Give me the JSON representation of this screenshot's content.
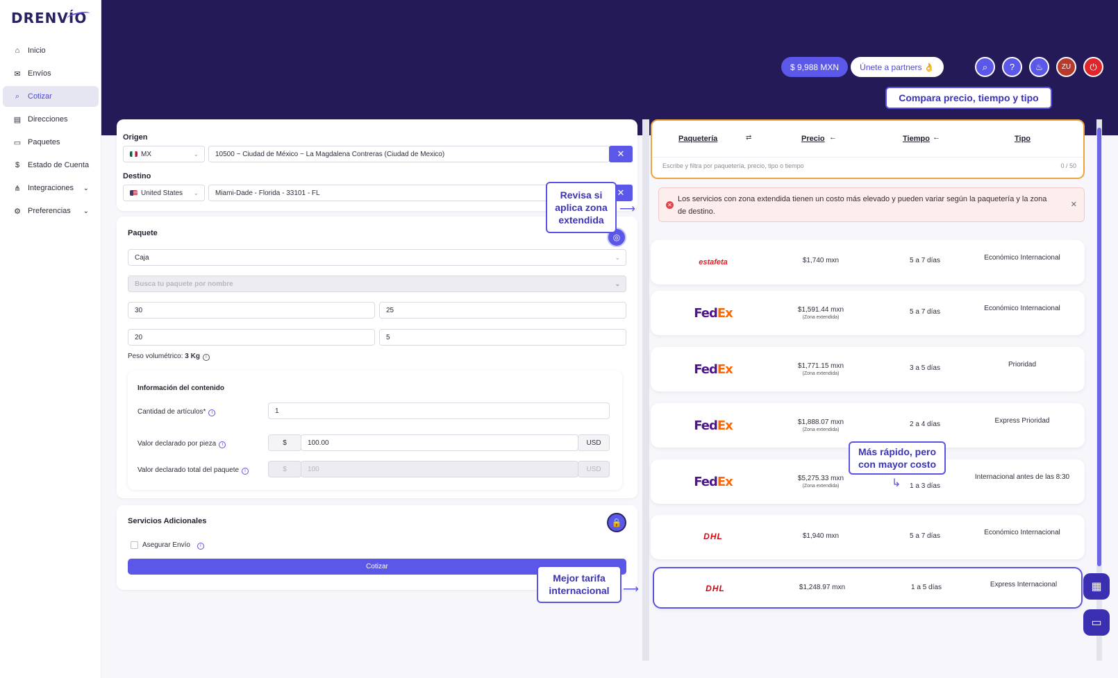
{
  "brand": {
    "name": "DRENVÍO"
  },
  "sidebar": {
    "items": [
      {
        "label": "Inicio",
        "icon": "home-icon",
        "glyph": "⌂"
      },
      {
        "label": "Envíos",
        "icon": "mail-icon",
        "glyph": "✉"
      },
      {
        "label": "Cotizar",
        "icon": "search-icon",
        "glyph": "⌕"
      },
      {
        "label": "Direcciones",
        "icon": "address-book-icon",
        "glyph": "▤"
      },
      {
        "label": "Paquetes",
        "icon": "lock-icon",
        "glyph": "▭"
      },
      {
        "label": "Estado de Cuenta",
        "icon": "dollar-icon",
        "glyph": "$"
      },
      {
        "label": "Integraciones",
        "icon": "network-icon",
        "glyph": "⋔"
      },
      {
        "label": "Preferencias",
        "icon": "gear-icon",
        "glyph": "⚙"
      }
    ]
  },
  "header": {
    "balance": "$ 9,988 MXN",
    "partners": "Únete a partners 👌",
    "avatar": "ZU"
  },
  "callouts": {
    "compare": "Compara precio, tiempo y tipo",
    "zone": "Revisa si aplica zona extendida",
    "faster": "Más rápido, pero con mayor costo",
    "best": "Mejor tarifa internacional"
  },
  "form": {
    "origin_label": "Origen",
    "origin_country": "MX",
    "origin_address": "10500 ~ Ciudad de México ~ La Magdalena Contreras (Ciudad de Mexico)",
    "dest_label": "Destino",
    "dest_country": "United States",
    "dest_address": "Miami-Dade - Florida - 33101 - FL",
    "package_label": "Paquete",
    "package_type": "Caja",
    "package_search_placeholder": "Busca tu paquete por nombre",
    "dim1": "30",
    "dim2": "25",
    "dim3": "20",
    "weight": "5",
    "vol_weight_label": "Peso volumétrico:",
    "vol_weight_value": "3 Kg",
    "content_title": "Información del contenido",
    "qty_label": "Cantidad de artículos*",
    "qty_value": "1",
    "declared_label": "Valor declarado por pieza",
    "currency_symbol": "$",
    "declared_value": "100.00",
    "currency": "USD",
    "total_label": "Valor declarado total del paquete",
    "total_value": "100",
    "extra_title": "Servicios Adicionales",
    "insure_label": "Asegurar Envío",
    "submit": "Cotizar"
  },
  "results": {
    "headers": {
      "carrier": "Paquetería",
      "price": "Precio",
      "time": "Tiempo",
      "type": "Tipo"
    },
    "filter_placeholder": "Escribe y filtra por paquetería, precio, tipo o tiempo",
    "filter_count": "0 / 50",
    "alert": "Los servicios con zona extendida tienen un costo más elevado y pueden variar según la paquetería y la zona de destino.",
    "rows": [
      {
        "carrier": "estafeta",
        "price": "$1,740 mxn",
        "note": "",
        "time": "5 a 7 días",
        "type": "Económico Internacional"
      },
      {
        "carrier": "FedEx",
        "price": "$1,591.44 mxn",
        "note": "(Zona extendida)",
        "time": "5 a 7 días",
        "type": "Económico Internacional"
      },
      {
        "carrier": "FedEx",
        "price": "$1,771.15 mxn",
        "note": "(Zona extendida)",
        "time": "3 a 5 días",
        "type": "Prioridad"
      },
      {
        "carrier": "FedEx",
        "price": "$1,888.07 mxn",
        "note": "(Zona extendida)",
        "time": "2 a 4 días",
        "type": "Express Prioridad"
      },
      {
        "carrier": "FedEx",
        "price": "$5,275.33 mxn",
        "note": "(Zona extendida)",
        "time": "1 a 3 días",
        "type": "Internacional antes de las 8:30"
      },
      {
        "carrier": "DHL",
        "price": "$1,940 mxn",
        "note": "",
        "time": "5 a 7 días",
        "type": "Económico Internacional"
      },
      {
        "carrier": "DHL",
        "price": "$1,248.97 mxn",
        "note": "",
        "time": "1 a 5 días",
        "type": "Express Internacional"
      }
    ]
  },
  "colors": {
    "accent": "#5b57e8",
    "header_bg": "#241a58",
    "highlight": "#f0a33a"
  }
}
